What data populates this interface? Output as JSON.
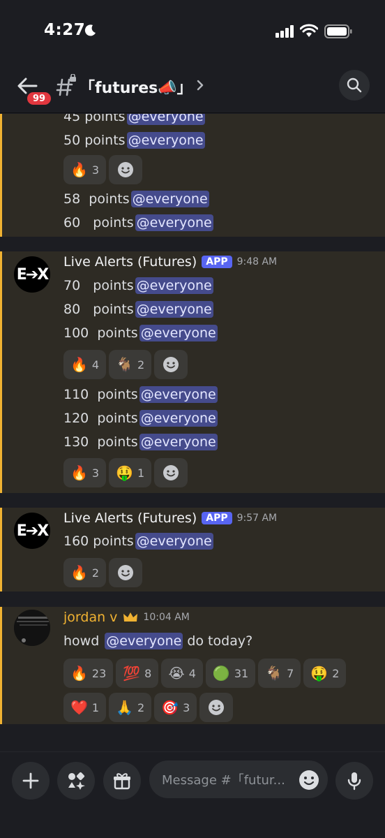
{
  "status": {
    "time": "4:27"
  },
  "header": {
    "badge": "99",
    "channel": "「futures📣」"
  },
  "messages": {
    "g1": {
      "lines": [
        {
          "pre": "45 points",
          "mention": "@everyone"
        },
        {
          "pre": "50 points",
          "mention": "@everyone"
        },
        {
          "pre": "58  points",
          "mention": "@everyone"
        },
        {
          "pre": "60   points",
          "mention": "@everyone"
        }
      ],
      "reactions": [
        {
          "emoji": "🔥",
          "count": "3"
        }
      ]
    },
    "g2": {
      "author": "Live Alerts (Futures)",
      "tag": "APP",
      "time": "9:48 AM",
      "lines": [
        {
          "pre": "70   points",
          "mention": "@everyone"
        },
        {
          "pre": "80   points",
          "mention": "@everyone"
        },
        {
          "pre": "100  points",
          "mention": "@everyone"
        },
        {
          "pre": "110  points",
          "mention": "@everyone"
        },
        {
          "pre": "120  points",
          "mention": "@everyone"
        },
        {
          "pre": "130  points",
          "mention": "@everyone"
        }
      ],
      "reactions_a": [
        {
          "emoji": "🔥",
          "count": "4"
        },
        {
          "emoji": "🐐",
          "count": "2"
        }
      ],
      "reactions_b": [
        {
          "emoji": "🔥",
          "count": "3"
        },
        {
          "emoji": "🤑",
          "count": "1"
        }
      ]
    },
    "g3": {
      "author": "Live Alerts (Futures)",
      "tag": "APP",
      "time": "9:57 AM",
      "lines": [
        {
          "pre": "160 points",
          "mention": "@everyone"
        }
      ],
      "reactions": [
        {
          "emoji": "🔥",
          "count": "2"
        }
      ]
    },
    "g4": {
      "author": "jordan v",
      "time": "10:04 AM",
      "text_pre": "howd",
      "mention": "@everyone",
      "text_post": "do today?",
      "reactions_a": [
        {
          "emoji": "🔥",
          "count": "23"
        },
        {
          "emoji": "💯",
          "count": "8"
        },
        {
          "emoji": "😭",
          "count": "4"
        },
        {
          "emoji": "🟢",
          "count": "31"
        },
        {
          "emoji": "🐐",
          "count": "7"
        },
        {
          "emoji": "🤑",
          "count": "2"
        }
      ],
      "reactions_b": [
        {
          "emoji": "❤️",
          "count": "1"
        },
        {
          "emoji": "🙏",
          "count": "2"
        },
        {
          "emoji": "🎯",
          "count": "3"
        }
      ]
    }
  },
  "avatars": {
    "app_logo": "E➔X"
  },
  "composer": {
    "placeholder": "Message #「futur..."
  },
  "icons": {
    "back": "arrow-left-icon",
    "channel": "locked-hashtag-icon",
    "search": "search-icon",
    "plus": "plus-icon",
    "apps": "apps-icon",
    "gift": "gift-icon",
    "emoji": "smiley-icon",
    "mic": "microphone-icon"
  },
  "colors": {
    "accent": "#5865f2",
    "highlight_bar": "#f0b232",
    "badge": "#e2373f",
    "mention_bg": "#454b8c"
  }
}
